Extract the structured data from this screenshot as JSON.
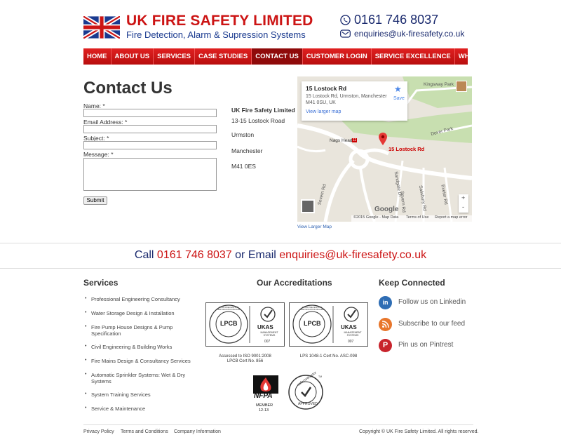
{
  "header": {
    "title": "UK FIRE SAFETY LIMITED",
    "subtitle": "Fire Detection, Alarm & Supression Systems",
    "phone": "0161 746 8037",
    "email": "enquiries@uk-firesafety.co.uk"
  },
  "nav": {
    "items": [
      {
        "label": "HOME"
      },
      {
        "label": "ABOUT US"
      },
      {
        "label": "SERVICES"
      },
      {
        "label": "CASE STUDIES"
      },
      {
        "label": "CONTACT US"
      },
      {
        "label": "CUSTOMER LOGIN"
      },
      {
        "label": "SERVICE EXCELLENCE"
      },
      {
        "label": "WHY CHOOSE UK FIRE SAFETY"
      }
    ],
    "active": "CONTACT US"
  },
  "contact": {
    "title": "Contact Us",
    "name_label": "Name: *",
    "email_label": "Email Address: *",
    "subject_label": "Subject: *",
    "message_label": "Message: *",
    "submit_label": "Submit",
    "address": {
      "company": "UK Fire Safety Limited",
      "line1": "13-15 Lostock Road",
      "line2": "Urmston",
      "line3": "Manchester",
      "line4": "M41 0ES"
    }
  },
  "map": {
    "card_title": "15 Lostock Rd",
    "card_address": "15 Lostock Rd, Urmston, Manchester M41 0SU, UK",
    "card_link": "View larger map",
    "save_label": "Save",
    "pin_label": "15 Lostock Rd",
    "labels": {
      "kingsway": "Kingsway Park",
      "dover": "Dover Park",
      "nags": "Nags Head",
      "sandgate": "Sandgate Dr",
      "severn": "Severn Rd",
      "salisbury": "Salisbury Rd",
      "exeter": "Exeter Rd",
      "severnrd2": "Severn Rd"
    },
    "road_badge": "11",
    "google": "Google",
    "footer_data": "©2015 Google - Map Data",
    "footer_terms": "Terms of Use",
    "footer_report": "Report a map error",
    "zoom_in": "+",
    "zoom_out": "-",
    "below_link": "View Larger Map"
  },
  "cta": {
    "call_prefix": "Call ",
    "phone": "0161 746 8037",
    "middle": " or Email ",
    "email": "enquiries@uk-firesafety.co.uk"
  },
  "services": {
    "heading": "Services",
    "items": [
      "Professional Engineering Consultancy",
      "Water Storage Design & Installation",
      "Fire Pump House Designs & Pump Specification",
      "Civil Engineering & Building Works",
      "Fire Mains Design & Consultancy Services",
      "Automatic Sprinkler Systems: Wet & Dry Systems",
      "System Training Services",
      "Service & Maintenance"
    ]
  },
  "accreditations": {
    "heading": "Our Accreditations",
    "lpcb": "LPCB",
    "ukas": "UKAS",
    "ukas_sub": "MANAGEMENT SYSTEMS",
    "code": "007",
    "ring_text": "LOSS PREVENTION CERTIFICATION BOARD",
    "cap1a": "Assessed to ISO 9001:2008",
    "cap1b": "LPCB Cert No. 856",
    "cap2": "LPS 1048-1 Cert No. ASC-098",
    "nfpa": "NFPA",
    "nfpa_member": "MEMBER",
    "nfpa_years": "12-13",
    "safe_top": "safecontractor",
    "safe_bottom": "APPROVED",
    "safe_tm": "TM"
  },
  "social": {
    "heading": "Keep Connected",
    "items": [
      {
        "label": "Follow us on Linkedin",
        "icon": "linkedin-icon",
        "color": "#2e6db4"
      },
      {
        "label": "Subscribe to our feed",
        "icon": "rss-icon",
        "color": "#e8762b"
      },
      {
        "label": "Pin us on Pintrest",
        "icon": "pinterest-icon",
        "color": "#c8232c"
      }
    ]
  },
  "footer": {
    "privacy": "Privacy Policy",
    "terms": "Terms and Conditions",
    "company": "Company Information",
    "copyright": "Copyright © UK Fire Safety Limited. All rights reserved."
  },
  "colors": {
    "brand_red": "#cc1414",
    "brand_blue": "#1a2a6e",
    "nav_active": "#8f0a0a"
  }
}
